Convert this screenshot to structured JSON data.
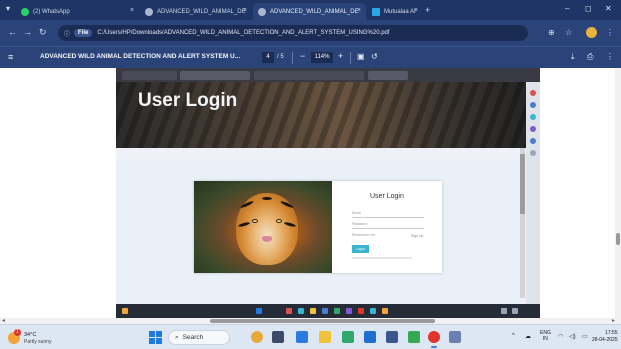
{
  "browser": {
    "tabs": [
      {
        "label": "(2) WhatsApp",
        "favicon_color": "#25d366"
      },
      {
        "label": "ADVANCED_WILD_ANIMAL_DE",
        "favicon_color": "#a9b6cf"
      },
      {
        "label": "ADVANCED_WILD_ANIMAL_DE",
        "favicon_color": "#a9b6cf"
      },
      {
        "label": "Mutualaa AI",
        "favicon_color": "#2aa7e8"
      }
    ],
    "close_glyph": "×",
    "new_tab_glyph": "+",
    "address_chip": "File",
    "address_url": "C:/Users/HP/Downloads/ADVANCED_WILD_ANIMAL_DETECTION_AND_ALERT_SYSTEM_USING%20.pdf"
  },
  "pdf_toolbar": {
    "title": "ADVANCED WILD ANIMAL DETECTION AND ALERT SYSTEM U...",
    "current_page": "4",
    "total_pages": "/ 5",
    "zoom": "114%"
  },
  "embedded": {
    "hero_title": "User Login",
    "form": {
      "title": "User Login",
      "email_placeholder": "Email",
      "password_placeholder": "Password",
      "remember_label": "Remember me",
      "signup_label": "Sign Up",
      "login_button": "Login"
    }
  },
  "taskbar": {
    "weather_badge": "1",
    "weather_temp": "34°C",
    "weather_condition": "Partly sunny",
    "search_label": "Search",
    "tray_lang_top": "ENG",
    "tray_lang_bottom": "IN",
    "clock_time": "17:55",
    "clock_date": "28-04-2025"
  },
  "colors": {
    "browser_frame": "#1f3566",
    "accent_button": "#3ab5cf",
    "taskbar": "#dde6f3"
  }
}
